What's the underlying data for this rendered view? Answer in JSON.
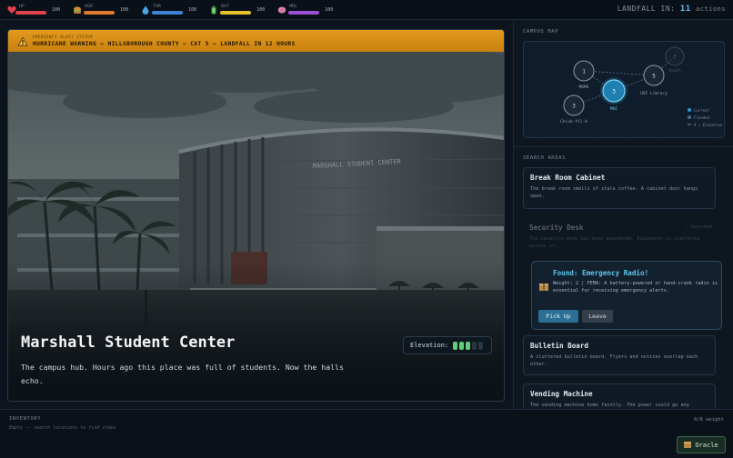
{
  "stats": [
    {
      "label": "HP",
      "value": "100",
      "color": "#e0424e",
      "icon": "heart-icon"
    },
    {
      "label": "HGR",
      "value": "100",
      "color": "#e07a2c",
      "icon": "food-icon"
    },
    {
      "label": "THR",
      "value": "100",
      "color": "#3d84d8",
      "icon": "water-drop-icon"
    },
    {
      "label": "BAT",
      "value": "100",
      "color": "#e6c12c",
      "icon": "battery-icon"
    },
    {
      "label": "MRL",
      "value": "100",
      "color": "#9b4ed6",
      "icon": "brain-icon"
    }
  ],
  "landfall": {
    "label": "LANDFALL IN:",
    "count": "11",
    "unit": "actions"
  },
  "alert": {
    "system": "EMERGENCY ALERT SYSTEM",
    "message": "HURRICANE WARNING — HILLSBOROUGH COUNTY — CAT 5 — LANDFALL IN 12 HOURS"
  },
  "location": {
    "title": "Marshall Student Center",
    "description": "The campus hub. Hours ago this place was full of students. Now the halls echo.",
    "elevation_label": "Elevation:",
    "elevation_level": 3,
    "elevation_max": 5
  },
  "building_sign": "MARSHALL STUDENT CENTER",
  "map": {
    "title": "CAMPUS MAP",
    "nodes": [
      {
        "num": "1",
        "label": "MOMA",
        "state": "normal"
      },
      {
        "num": "3",
        "label": "MSC",
        "state": "current"
      },
      {
        "num": "5",
        "label": "USF Library",
        "state": "normal"
      },
      {
        "num": "3",
        "label": "Chick-fil-A",
        "state": "normal"
      },
      {
        "num": "?",
        "label": "Beach",
        "state": "flooded"
      }
    ],
    "legend": [
      "Current",
      "Flooded",
      "# = Elevation"
    ]
  },
  "search": {
    "title": "SEARCH AREAS",
    "areas": [
      {
        "title": "Break Room Cabinet",
        "desc": "The break room smells of stale coffee. A cabinet door hangs open.",
        "searched": false
      },
      {
        "title": "Security Desk",
        "desc": "The security desk has been abandoned. Equipment is scattered across it.",
        "searched": true,
        "status": "✓ Searched"
      },
      {
        "title": "Bulletin Board",
        "desc": "A cluttered bulletin board. Flyers and notices overlap each other.",
        "searched": false
      },
      {
        "title": "Vending Machine",
        "desc": "The vending machine hums faintly. The power could go any",
        "searched": false
      }
    ]
  },
  "found": {
    "title": "Found: Emergency Radio!",
    "desc": "Weight: 2 | FEMA: A battery-powered or hand-crank radio is essential for receiving emergency alerts.",
    "pick_label": "Pick Up",
    "leave_label": "Leave"
  },
  "inventory": {
    "title": "INVENTORY",
    "empty": "Empty -- search locations to find items",
    "weight": "0/8 weight"
  },
  "oracle": {
    "label": "Oracle"
  }
}
